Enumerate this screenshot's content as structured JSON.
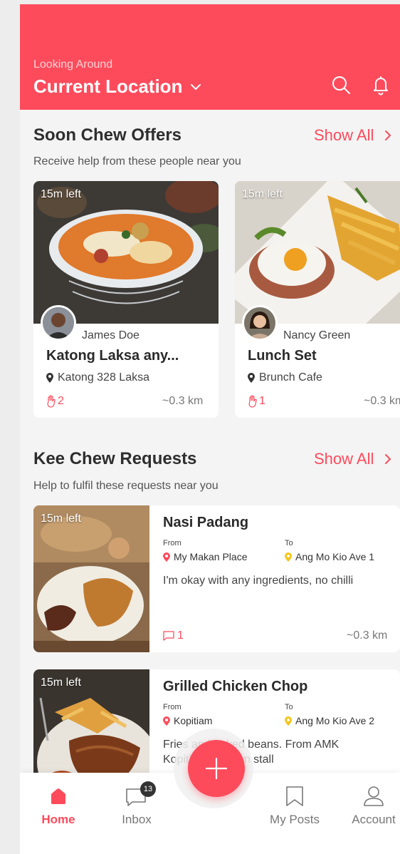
{
  "header": {
    "looking_label": "Looking Around",
    "location": "Current Location",
    "accent_color": "#fe4b5c"
  },
  "offers": {
    "title": "Soon Chew Offers",
    "subtitle": "Receive help from these people near you",
    "show_all": "Show All",
    "items": [
      {
        "time_left": "15m left",
        "user": "James Doe",
        "title": "Katong Laksa any...",
        "place": "Katong 328 Laksa",
        "count": "2",
        "distance": "~0.3 km"
      },
      {
        "time_left": "15m left",
        "user": "Nancy Green",
        "title": "Lunch Set",
        "place": "Brunch Cafe",
        "count": "1",
        "distance": "~0.3 km"
      }
    ]
  },
  "requests": {
    "title": "Kee Chew Requests",
    "subtitle": "Help to fulfil these requests near you",
    "show_all": "Show All",
    "from_label": "From",
    "to_label": "To",
    "items": [
      {
        "time_left": "15m left",
        "title": "Nasi Padang",
        "from": "My Makan Place",
        "to": "Ang Mo Kio Ave 1",
        "description": "I'm okay with any ingredients, no chilli",
        "count": "1",
        "distance": "~0.3 km"
      },
      {
        "time_left": "15m left",
        "title": "Grilled Chicken Chop",
        "from": "Kopitiam",
        "to": "Ang Mo Kio Ave 2",
        "description": "Fries and baked beans. From AMK Kopitiam western stall",
        "count": "",
        "distance": ""
      }
    ]
  },
  "tabbar": {
    "home": "Home",
    "inbox": "Inbox",
    "inbox_badge": "13",
    "my_posts": "My Posts",
    "account": "Account"
  }
}
